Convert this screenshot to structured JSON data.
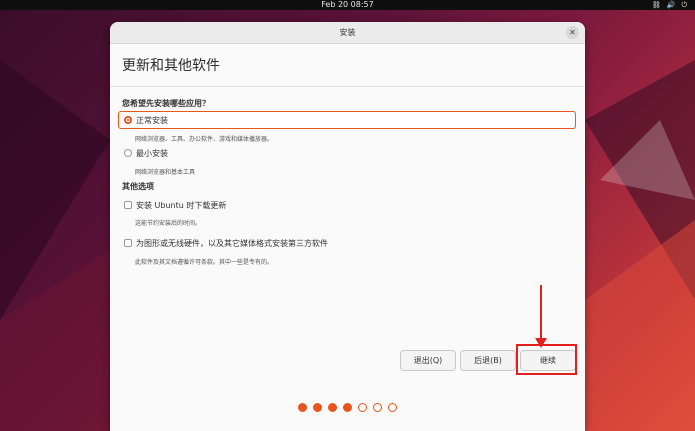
{
  "topbar": {
    "datetime": "Feb 20  08:57"
  },
  "window": {
    "title": "安装",
    "page_title": "更新和其他软件",
    "question": "您希望先安装哪些应用？",
    "install_options": [
      {
        "label": "正常安装",
        "description": "网络浏览器、工具、办公软件、游戏和媒体播放器。",
        "selected": true
      },
      {
        "label": "最小安装",
        "description": "网络浏览器和基本工具",
        "selected": false
      }
    ],
    "other_section": "其他选项",
    "other_options": [
      {
        "label": "安装 Ubuntu 时下载更新",
        "description": "这能节约安装后的时间。",
        "checked": false
      },
      {
        "label": "为图形或无线硬件，以及其它媒体格式安装第三方软件",
        "description": "此软件及其文档遵循许可条款。其中一些是专有的。",
        "checked": false
      }
    ],
    "buttons": {
      "quit": "退出(Q)",
      "back": "后退(B)",
      "continue": "继续"
    },
    "progress": {
      "current_step": 4,
      "total_steps": 7
    }
  },
  "colors": {
    "accent": "#e9541f",
    "highlight": "#e41f1f"
  },
  "icons": [
    "network-icon",
    "volume-icon",
    "power-icon",
    "close-icon"
  ]
}
